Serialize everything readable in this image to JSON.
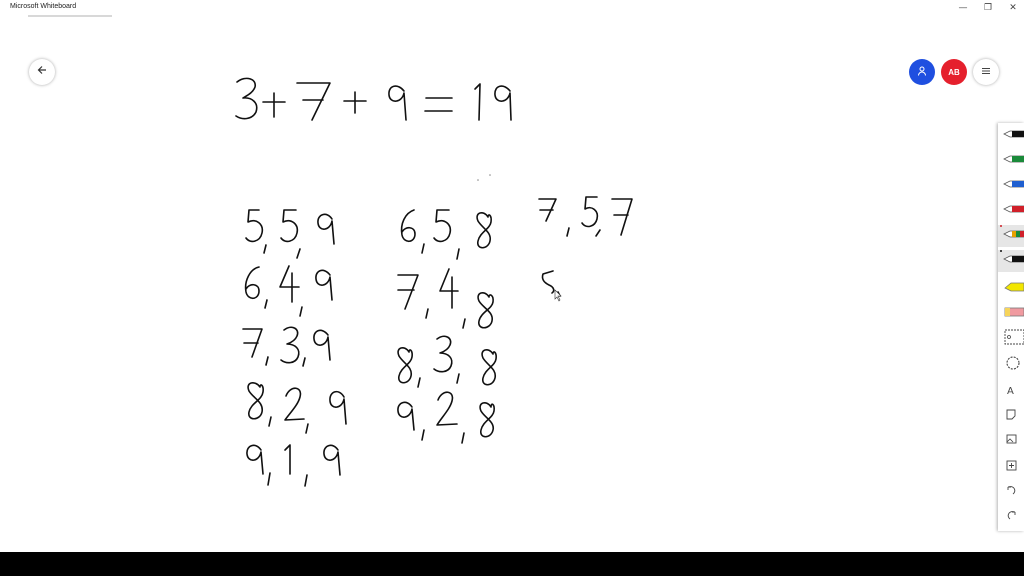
{
  "window": {
    "title": "Microsoft Whiteboard",
    "minimize_glyph": "—",
    "restore_glyph": "❐",
    "close_glyph": "✕"
  },
  "header": {
    "avatar_initials": "AB",
    "invite_icon": "person-icon",
    "menu_icon": "hamburger-icon",
    "back_icon": "arrow-left-icon"
  },
  "toolbar": {
    "tools": [
      {
        "name": "pen-black",
        "color": "#111111"
      },
      {
        "name": "pen-green",
        "color": "#1a8a3a"
      },
      {
        "name": "pen-blue",
        "color": "#1f5fd0"
      },
      {
        "name": "pen-red",
        "color": "#d0202a"
      },
      {
        "name": "pen-rainbow",
        "color": "#e8a000",
        "selected": true
      },
      {
        "name": "pen-galaxy",
        "color": "#111111",
        "selected": true
      },
      {
        "name": "highlighter",
        "color": "#f2e600"
      },
      {
        "name": "eraser",
        "color": "#f09aa0"
      },
      {
        "name": "ruler-icon",
        "color": "#444444"
      },
      {
        "name": "lasso-icon",
        "color": "#444444"
      }
    ],
    "text_tool_label": "A",
    "note_icon": "sticky-note-icon",
    "image_icon": "image-icon",
    "add_icon": "add-icon",
    "undo_icon": "undo-icon",
    "redo_icon": "redo-icon"
  },
  "colors": {
    "invite": "#1f4fe0",
    "avatar": "#e5202d",
    "ink": "#111111"
  },
  "ink_strokes": [
    "3 + 7 + 9 = 19",
    "5, 5, 9",
    "6, 4, 9",
    "7, 3, 9",
    "8, 2, 9",
    "9, 1, 9",
    "6, 5, 8",
    "7, 4, 8",
    "8, 3, 8",
    "9, 2, 8",
    "7, 5, 7",
    "5"
  ]
}
